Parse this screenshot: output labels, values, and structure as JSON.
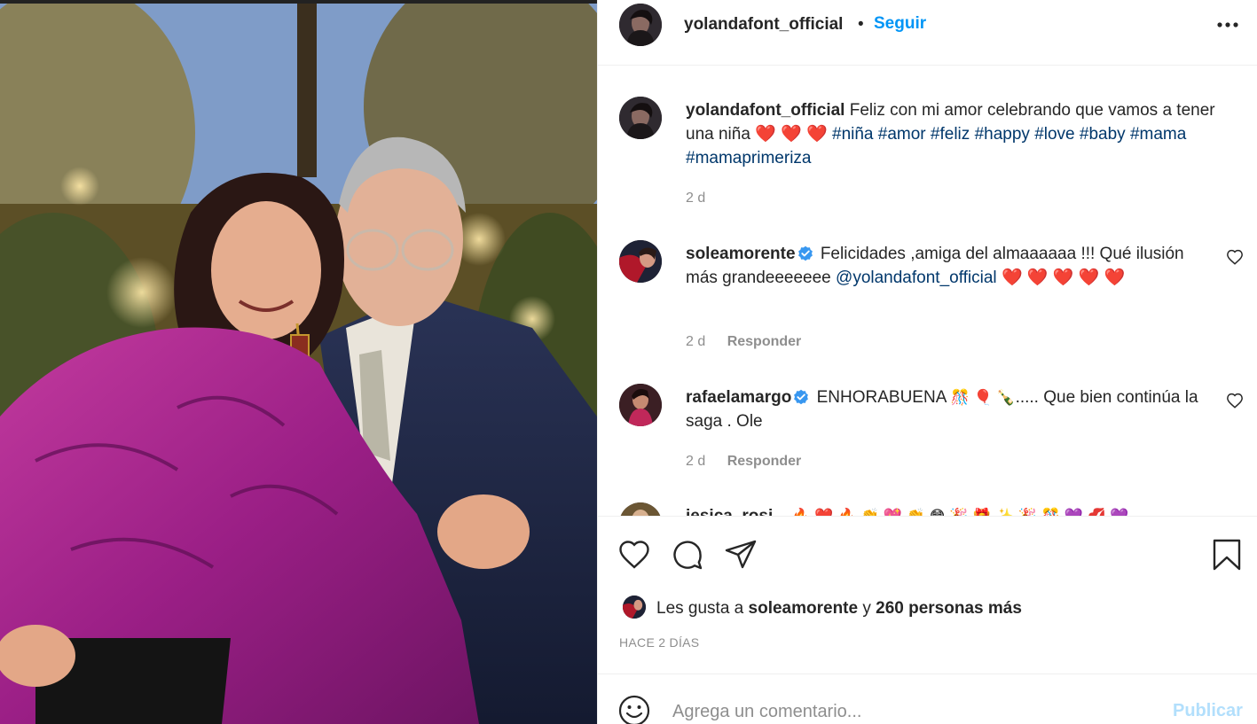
{
  "colors": {
    "accent": "#0095f6",
    "link": "#00376b",
    "muted": "#8e8e8e",
    "heart": "#e0245e",
    "publish_disabled": "#b2dffc"
  },
  "header": {
    "username": "yolandafont_official",
    "separator": "•",
    "follow_label": "Seguir",
    "more_icon": "more-horizontal-icon"
  },
  "caption": {
    "username": "yolandafont_official",
    "text_before": "Feliz con mi amor celebrando que vamos a tener una niña",
    "hearts": "❤️ ❤️ ❤️",
    "hashtags": [
      "#niña",
      "#amor",
      "#feliz",
      "#happy",
      "#love",
      "#baby",
      "#mama",
      "#mamaprimeriza"
    ],
    "time": "2 d"
  },
  "comments": [
    {
      "username": "soleamorente",
      "verified": true,
      "text_before": "Felicidades ,amiga del almaaaaaa !!! Qué ilusión más grandeeeeeee",
      "mention": "@yolandafont_official",
      "hearts": "❤️ ❤️ ❤️ ❤️ ❤️",
      "time": "2 d",
      "reply_label": "Responder"
    },
    {
      "username": "rafaelamargo",
      "verified": true,
      "text_before": "ENHORABUENA",
      "emojis": "🎊 🎈 🍾",
      "text_after": "..... Que bien continúa la saga . Ole",
      "time": "2 d",
      "reply_label": "Responder"
    },
    {
      "partial_username": "jesica_rosi...",
      "emojis": "🔥 ❤️ 🔥 👏 💖 👏 😳 🎉 🎁 ✨ 🎉 🎊 💜 💋 💜"
    }
  ],
  "actions": {
    "like_icon": "heart-outline-icon",
    "comment_icon": "comment-icon",
    "share_icon": "share-icon",
    "save_icon": "bookmark-icon"
  },
  "likes": {
    "prefix": "Les gusta a",
    "user": "soleamorente",
    "conj": "y",
    "others": "260 personas más"
  },
  "time_ago": "HACE 2 DÍAS",
  "comment_box": {
    "placeholder": "Agrega un comentario...",
    "publish_label": "Publicar",
    "emoji_icon": "smiley-icon"
  }
}
